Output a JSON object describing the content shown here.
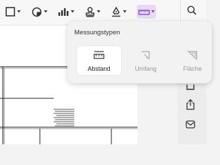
{
  "toolbar": {
    "items": [
      {
        "icon": "rectangle-shape-icon"
      },
      {
        "icon": "fill-color-icon"
      },
      {
        "icon": "chart-bars-icon"
      },
      {
        "icon": "stamp-icon"
      },
      {
        "icon": "signature-pen-icon"
      },
      {
        "icon": "measure-ruler-icon",
        "active": true
      }
    ],
    "search_icon": "search-icon",
    "active_color": "#e7d8f4",
    "accent_color": "#8a3fc7"
  },
  "popover": {
    "title": "Messungstypen",
    "options": [
      {
        "label": "Abstand",
        "icon": "ruler-distance-icon",
        "selected": true
      },
      {
        "label": "Umfang",
        "icon": "perimeter-icon",
        "selected": false
      },
      {
        "label": "Fläche",
        "icon": "area-icon",
        "selected": false
      }
    ]
  },
  "side_toolbar": {
    "items": [
      {
        "icon": "copy-icon"
      },
      {
        "icon": "share-icon"
      },
      {
        "icon": "mail-icon"
      }
    ]
  }
}
